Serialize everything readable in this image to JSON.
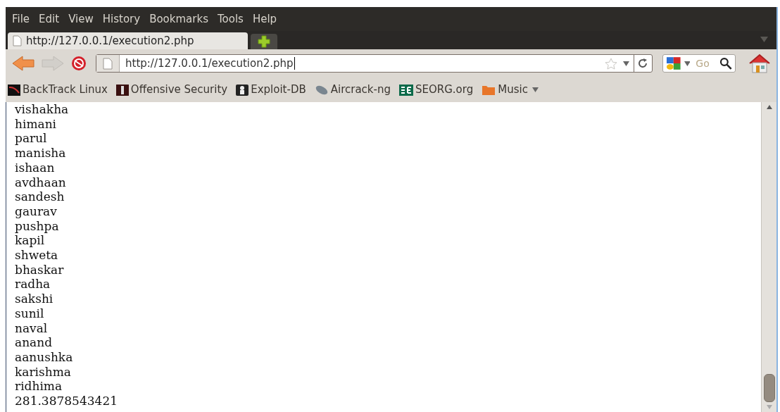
{
  "menu": [
    "File",
    "Edit",
    "View",
    "History",
    "Bookmarks",
    "Tools",
    "Help"
  ],
  "tabs": [
    {
      "title": "http://127.0.0.1/execution2.php",
      "selected": true
    }
  ],
  "address_bar": {
    "value": "http://127.0.0.1/execution2.php"
  },
  "search": {
    "placeholder": "Go"
  },
  "bookmarks": [
    {
      "label": "BackTrack Linux",
      "kind": "backtrack",
      "menu": false
    },
    {
      "label": "Offensive Security",
      "kind": "offsec",
      "menu": false
    },
    {
      "label": "Exploit-DB",
      "kind": "exploitdb",
      "menu": false
    },
    {
      "label": "Aircrack-ng",
      "kind": "aircrack",
      "menu": false
    },
    {
      "label": "SEORG.org",
      "kind": "seorg",
      "menu": false
    },
    {
      "label": "Music",
      "kind": "folder",
      "menu": true
    }
  ],
  "content_lines": [
    "vishakha",
    "himani",
    "parul",
    "manisha",
    "ishaan",
    "avdhaan",
    "sandesh",
    "gaurav",
    "pushpa",
    "kapil",
    "shweta",
    "bhaskar",
    "radha",
    "sakshi",
    "sunil",
    "naval",
    "anand",
    "aanushka",
    "karishma",
    "ridhima",
    "281.3878543421"
  ]
}
